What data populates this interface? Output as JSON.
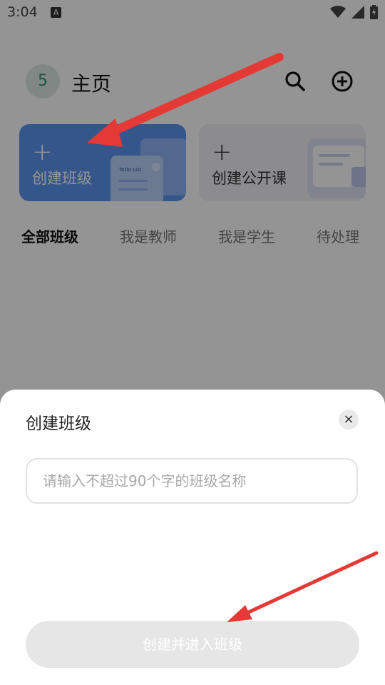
{
  "status_bar": {
    "time": "3:04",
    "notification_letter": "A"
  },
  "header": {
    "avatar_text": "5",
    "title": "主页"
  },
  "cards": [
    {
      "plus": "+",
      "label": "创建班级"
    },
    {
      "plus": "+",
      "label": "创建公开课"
    }
  ],
  "illustration": {
    "todo_title": "ToDo List"
  },
  "tabs": [
    {
      "label": "全部班级",
      "active": true
    },
    {
      "label": "我是教师",
      "active": false
    },
    {
      "label": "我是学生",
      "active": false
    },
    {
      "label": "待处理",
      "active": false
    }
  ],
  "sheet": {
    "title": "创建班级",
    "close_icon": "×",
    "input_placeholder": "请输入不超过90个字的班级名称",
    "input_value": "",
    "submit_label": "创建并进入班级"
  },
  "colors": {
    "card_primary": "#5c95f0",
    "arrow_red": "#e53935",
    "disabled_button": "#e6e6e6"
  }
}
